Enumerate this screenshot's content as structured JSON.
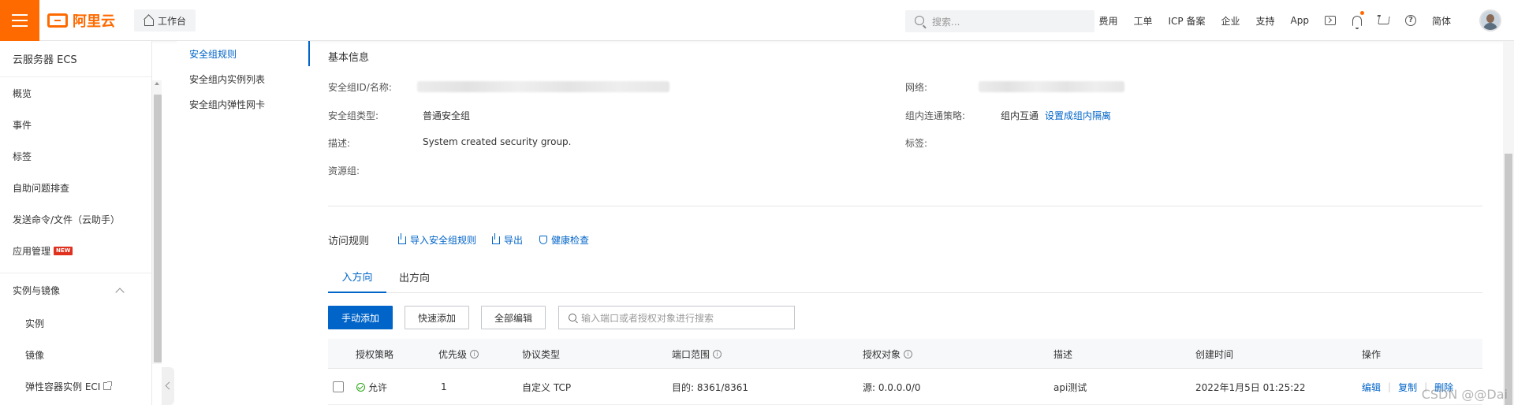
{
  "topbar": {
    "logo_text": "阿里云",
    "workbench_label": "工作台",
    "search_placeholder": "搜索...",
    "nav": [
      "费用",
      "工单",
      "ICP 备案",
      "企业",
      "支持",
      "App"
    ],
    "lang": "简体",
    "accent_color": "#ff6a00"
  },
  "sidebar": {
    "title": "云服务器 ECS",
    "items": [
      "概览",
      "事件",
      "标签",
      "自助问题排查",
      "发送命令/文件（云助手）",
      "应用管理"
    ],
    "new_badge": "NEW",
    "group": "实例与镜像",
    "sub_items": [
      "实例",
      "镜像",
      "弹性容器实例 ECI"
    ]
  },
  "subnav": {
    "items": [
      "安全组规则",
      "安全组内实例列表",
      "安全组内弹性网卡"
    ],
    "active_index": 0
  },
  "basic_info": {
    "title": "基本信息",
    "id_label": "安全组ID/名称:",
    "network_label": "网络:",
    "type_label": "安全组类型:",
    "type_value": "普通安全组",
    "policy_label": "组内连通策略:",
    "policy_value": "组内互通",
    "policy_link": "设置成组内隔离",
    "desc_label": "描述:",
    "desc_value": "System created security group.",
    "tags_label": "标签:",
    "resource_group_label": "资源组:"
  },
  "rules": {
    "title": "访问规则",
    "actions": [
      "导入安全组规则",
      "导出",
      "健康检查"
    ],
    "tabs": [
      "入方向",
      "出方向"
    ],
    "active_tab": 0,
    "buttons": {
      "add_manual": "手动添加",
      "add_quick": "快速添加",
      "edit_all": "全部编辑"
    },
    "search_placeholder": "输入端口或者授权对象进行搜索",
    "columns": [
      "授权策略",
      "优先级",
      "协议类型",
      "端口范围",
      "授权对象",
      "描述",
      "创建时间",
      "操作"
    ],
    "rows": [
      {
        "policy": "允许",
        "priority": "1",
        "protocol": "自定义 TCP",
        "port": "目的: 8361/8361",
        "source": "源: 0.0.0.0/0",
        "description": "api测试",
        "created": "2022年1月5日 01:25:22",
        "ops": [
          "编辑",
          "复制",
          "删除"
        ]
      }
    ]
  },
  "watermark": "CSDN @@Dai"
}
